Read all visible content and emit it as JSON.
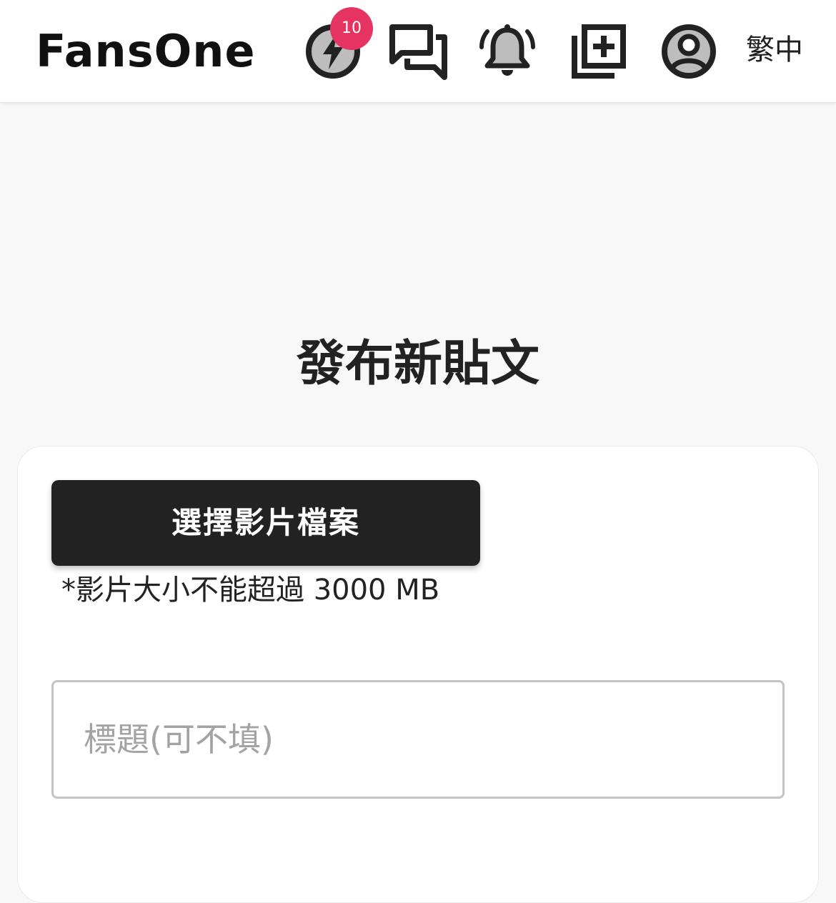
{
  "header": {
    "brand": "FansOne",
    "badge_count": "10",
    "language": "繁中",
    "icons": [
      "lightning-icon",
      "chat-icon",
      "bell-icon",
      "add-post-icon",
      "account-icon"
    ]
  },
  "main": {
    "title": "發布新貼文",
    "upload_button_label": "選擇影片檔案",
    "size_note": "*影片大小不能超過 3000 MB",
    "title_input": {
      "placeholder": "標題(可不填)",
      "value": ""
    }
  },
  "colors": {
    "badge": "#e63462",
    "button": "#222222",
    "background": "#f8f8f8"
  }
}
